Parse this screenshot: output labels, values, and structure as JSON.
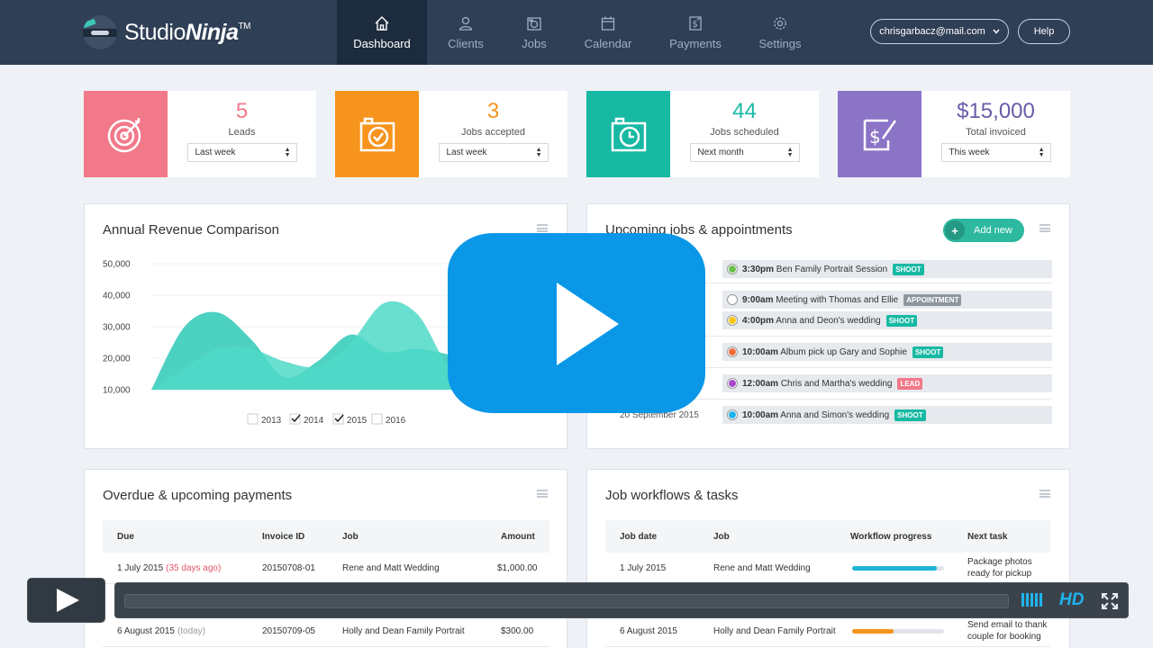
{
  "app": {
    "logo_prefix": "Studio",
    "logo_suffix": "Ninja",
    "logo_tm": "TM"
  },
  "nav": {
    "items": [
      {
        "label": "Dashboard",
        "icon": "home-icon",
        "active": true
      },
      {
        "label": "Clients",
        "icon": "clients-icon",
        "active": false
      },
      {
        "label": "Jobs",
        "icon": "camera-icon",
        "active": false
      },
      {
        "label": "Calendar",
        "icon": "calendar-icon",
        "active": false
      },
      {
        "label": "Payments",
        "icon": "payments-icon",
        "active": false
      },
      {
        "label": "Settings",
        "icon": "gear-icon",
        "active": false
      }
    ],
    "user_email": "chrisgarbacz@mail.com",
    "help_label": "Help"
  },
  "stats": [
    {
      "value": "5",
      "label": "Leads",
      "period": "Last week",
      "color": "#f2798a",
      "value_color": "#f2798a",
      "icon": "target-icon"
    },
    {
      "value": "3",
      "label": "Jobs accepted",
      "period": "Last week",
      "color": "#f7941d",
      "value_color": "#f7941d",
      "icon": "camera-check-icon"
    },
    {
      "value": "44",
      "label": "Jobs scheduled",
      "period": "Next month",
      "color": "#17b9a3",
      "value_color": "#17b9a3",
      "icon": "camera-clock-icon"
    },
    {
      "value": "$15,000",
      "label": "Total invoiced",
      "period": "This week",
      "color": "#8b74c6",
      "value_color": "#6b5aa8",
      "icon": "invoice-icon"
    }
  ],
  "revenue": {
    "title": "Annual Revenue Comparison",
    "y_ticks": [
      "50,000",
      "40,000",
      "30,000",
      "20,000",
      "10,000"
    ],
    "legend": [
      {
        "label": "2013",
        "checked": false
      },
      {
        "label": "2014",
        "checked": true
      },
      {
        "label": "2015",
        "checked": true
      },
      {
        "label": "2016",
        "checked": false
      }
    ]
  },
  "chart_data": {
    "type": "area",
    "title": "Annual Revenue Comparison",
    "ylim": [
      10000,
      50000
    ],
    "x": [
      0,
      1,
      2,
      3,
      4,
      5,
      6,
      7,
      8,
      9,
      10,
      11
    ],
    "series": [
      {
        "name": "2014",
        "color": "#2ec9b6",
        "values": [
          10000,
          30000,
          34500,
          26000,
          14000,
          19000,
          27500,
          22000,
          23000,
          21000,
          18000,
          10000
        ]
      },
      {
        "name": "2015",
        "color": "#4fd9c8",
        "values": [
          10000,
          17000,
          23000,
          23000,
          19000,
          17500,
          25000,
          37500,
          34000,
          16500,
          13000,
          10000
        ]
      }
    ]
  },
  "upcoming": {
    "title": "Upcoming jobs & appointments",
    "add_label": "Add new",
    "rows": [
      {
        "date": "",
        "time": "3:30pm",
        "text": "Ben Family Portrait Session",
        "tag": "SHOOT",
        "tag_color": "#17b9a3",
        "dot": "#6cc04a"
      },
      {
        "date": "",
        "time": "9:00am",
        "text": "Meeting with Thomas and Ellie",
        "tag": "APPOINTMENT",
        "tag_color": "#8e969e",
        "dot": "#ffffff"
      },
      {
        "date": "",
        "time": "4:00pm",
        "text": "Anna and Deon's wedding",
        "tag": "SHOOT",
        "tag_color": "#17b9a3",
        "dot": "#f5c518"
      },
      {
        "date": "",
        "time": "10:00am",
        "text": "Album pick up Gary and Sophie",
        "tag": "SHOOT",
        "tag_color": "#17b9a3",
        "dot": "#f26b3a"
      },
      {
        "date": "",
        "time": "12:00am",
        "text": "Chris and Martha's wedding",
        "tag": "LEAD",
        "tag_color": "#f2798a",
        "dot": "#a64ac9"
      },
      {
        "date": "20 September 2015",
        "time": "10:00am",
        "text": "Anna and Simon's wedding",
        "tag": "SHOOT",
        "tag_color": "#17b9a3",
        "dot": "#1fb3f0"
      }
    ]
  },
  "payments": {
    "title": "Overdue & upcoming payments",
    "headers": {
      "due": "Due",
      "invoice": "Invoice ID",
      "job": "Job",
      "amount": "Amount"
    },
    "rows": [
      {
        "due": "1 July 2015",
        "note": "(35 days ago)",
        "note_type": "red",
        "invoice": "20150708-01",
        "job": "Rene and Matt Wedding",
        "amount": "$1,000.00"
      },
      {
        "due": "6 August 2015",
        "note": "(today)",
        "note_type": "grey",
        "invoice": "20150709-05",
        "job": "Holly and Dean Family Portrait",
        "amount": "$300.00"
      }
    ]
  },
  "workflows": {
    "title": "Job workflows & tasks",
    "headers": {
      "date": "Job date",
      "job": "Job",
      "progress": "Workflow progress",
      "next": "Next task"
    },
    "rows": [
      {
        "date": "1 July 2015",
        "job": "Rene and Matt Wedding",
        "progress": 0.92,
        "bar_color": "#1fb3d8",
        "next": "Package photos ready for pickup"
      },
      {
        "date": "6 August 2015",
        "job": "Holly and Dean Family Portrait",
        "progress": 0.45,
        "bar_color": "#f7941d",
        "next": "Send email to thank couple for booking"
      }
    ]
  },
  "player": {
    "quality": "HD"
  }
}
